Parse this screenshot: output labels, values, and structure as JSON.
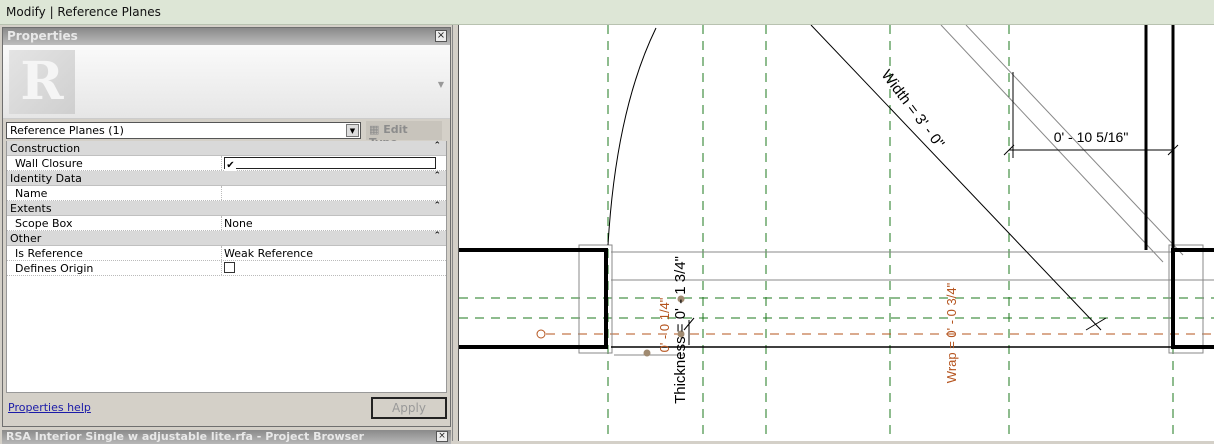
{
  "topbar": {
    "title": "Modify | Reference Planes"
  },
  "properties": {
    "title": "Properties",
    "close": "×",
    "type_selector": "Reference Planes (1)",
    "edit_type": "Edit Type",
    "groups": [
      {
        "label": "Construction",
        "rows": [
          {
            "name": "Wall Closure",
            "value": "",
            "checked": true
          }
        ]
      },
      {
        "label": "Identity Data",
        "rows": [
          {
            "name": "Name",
            "value": ""
          }
        ]
      },
      {
        "label": "Extents",
        "rows": [
          {
            "name": "Scope Box",
            "value": "None"
          }
        ]
      },
      {
        "label": "Other",
        "rows": [
          {
            "name": "Is Reference",
            "value": "Weak Reference"
          },
          {
            "name": "Defines Origin",
            "value": "",
            "checked": false
          }
        ]
      }
    ],
    "help_link": "Properties help",
    "apply": "Apply"
  },
  "browser": {
    "title": "RSA Interior Single w adjustable lite.rfa - Project Browser",
    "close": "×"
  },
  "canvas": {
    "dim_width": "Width = 3' - 0\"",
    "dim_offset": "0' - 10 5/16\"",
    "dim_thickness": "Thickness = 0' - 1 3/4\"",
    "dim_small": "0' - 0 1/4\"",
    "dim_wrap": "Wrap = 0' - 0 3/4\"",
    "colors": {
      "ref_plane": "#1e7a1e",
      "orange": "#b5541e"
    }
  }
}
